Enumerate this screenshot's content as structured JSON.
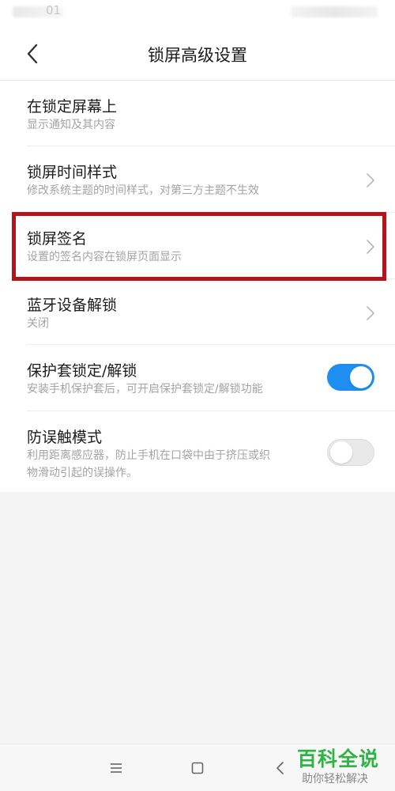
{
  "status_bar": {
    "time": "01"
  },
  "header": {
    "title": "锁屏高级设置",
    "back_icon": "chevron-left-icon"
  },
  "settings": [
    {
      "title": "在锁定屏幕上",
      "subtitle": "显示通知及其内容",
      "control": "none"
    },
    {
      "title": "锁屏时间样式",
      "subtitle": "修改系统主题的时间样式，对第三方主题不生效",
      "control": "chevron"
    },
    {
      "title": "锁屏签名",
      "subtitle": "设置的签名内容在锁屏页面显示",
      "control": "chevron",
      "highlighted": true
    },
    {
      "title": "蓝牙设备解锁",
      "subtitle": "关闭",
      "control": "chevron"
    },
    {
      "title": "保护套锁定/解锁",
      "subtitle": "安装手机保护套后，可开启保护套锁定/解锁功能",
      "control": "toggle",
      "toggle_on": true
    },
    {
      "title": "防误触模式",
      "subtitle_line1": "利用距离感应器，防止手机在口袋中由于挤压或织",
      "subtitle_line2": "物滑动引起的误操作。",
      "control": "toggle",
      "toggle_on": false
    }
  ],
  "nav_bar": {
    "icons": [
      "menu-icon",
      "home-icon",
      "back-icon"
    ]
  },
  "watermark": {
    "logo": "百科全说",
    "tagline": "助你轻松解决"
  },
  "colors": {
    "accent": "#1e8ff0",
    "highlight_border": "#b3151c",
    "watermark_green": "#2fb344"
  }
}
